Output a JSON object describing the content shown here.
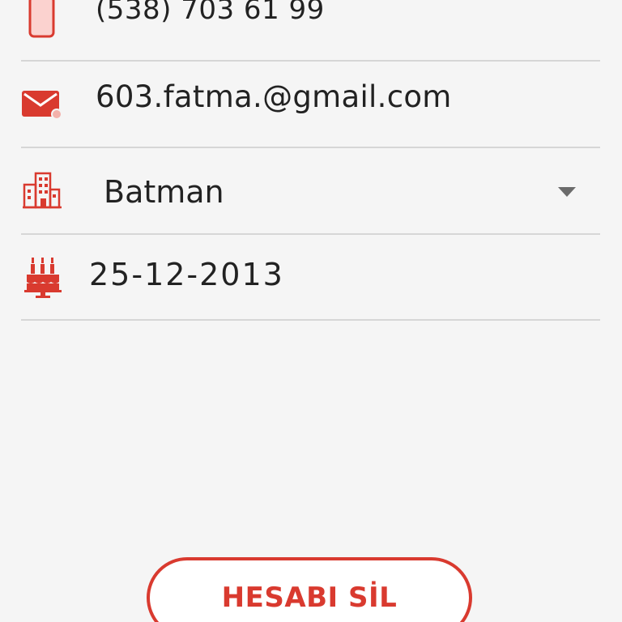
{
  "profile": {
    "phone": "(538) 703 61 99",
    "email": "603.fatma.@gmail.com",
    "city": "Batman",
    "birth_date": "25-12-2013"
  },
  "icons": {
    "phone": "phone-icon",
    "email": "mail-icon",
    "city": "city-buildings-icon",
    "birth_date": "birthday-cake-icon",
    "dropdown": "caret-down-icon"
  },
  "actions": {
    "delete_account_label": "HESABI SİL"
  },
  "colors": {
    "accent": "#d93a2f",
    "background": "#f5f5f5",
    "divider": "#d6d6d6",
    "text": "#222222"
  }
}
